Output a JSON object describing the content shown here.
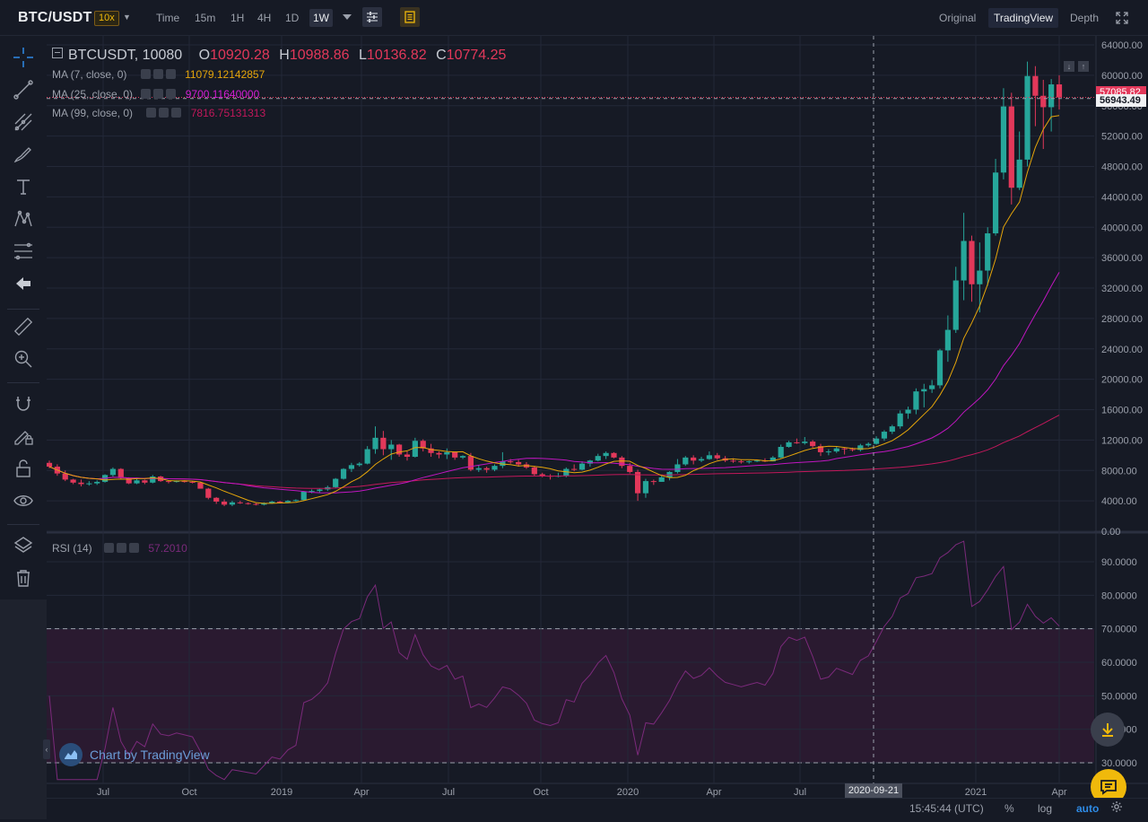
{
  "header": {
    "pair": "BTC/USDT",
    "leverage": "10x",
    "timeframes": [
      "Time",
      "15m",
      "1H",
      "4H",
      "1D",
      "1W"
    ],
    "active_timeframe": "1W",
    "views": [
      "Original",
      "TradingView",
      "Depth"
    ],
    "active_view": "TradingView"
  },
  "legend": {
    "symbol": "BTCUSDT, 10080",
    "open_label": "O",
    "open": "10920.28",
    "high_label": "H",
    "high": "10988.86",
    "low_label": "L",
    "low": "10136.82",
    "close_label": "C",
    "close": "10774.25",
    "ma7_label": "MA (7, close, 0)",
    "ma7_value": "11079.12142857",
    "ma25_label": "MA (25, close, 0)",
    "ma25_value": "9700.11640000",
    "ma99_label": "MA (99, close, 0)",
    "ma99_value": "7816.75131313",
    "rsi_label": "RSI (14)",
    "rsi_value": "57.2010"
  },
  "price_badges": {
    "last_price": "57085.82",
    "crosshair_price": "56943.49"
  },
  "crosshair_date": "2020-09-21",
  "branding": "Chart by TradingView",
  "footer": {
    "clock": "15:45:44 (UTC)",
    "percent": "%",
    "log": "log",
    "auto": "auto"
  },
  "colors": {
    "up": "#26a69a",
    "down": "#e2385a",
    "ma7": "#e5a50a",
    "ma25": "#c016c0",
    "ma99": "#c2185b",
    "rsi": "#7b2a7b",
    "accent": "#f0b90b",
    "background": "#161a25"
  },
  "icons": {
    "tools": [
      "crosshair-icon",
      "trend-line-icon",
      "pitchfork-icon",
      "brush-icon",
      "text-icon",
      "pattern-icon",
      "fib-icon",
      "back-arrow-icon",
      "ruler-icon",
      "zoom-in-icon",
      "magnet-icon",
      "lock-drawing-icon",
      "lock-icon",
      "eye-icon",
      "layers-icon",
      "trash-icon"
    ]
  },
  "chart_data": {
    "type": "candlestick",
    "price_axis": {
      "ticks": [
        "64000.00",
        "60000.00",
        "56000.00",
        "52000.00",
        "48000.00",
        "44000.00",
        "40000.00",
        "36000.00",
        "32000.00",
        "28000.00",
        "24000.00",
        "20000.00",
        "16000.00",
        "12000.00",
        "8000.00",
        "4000.00",
        "0.00"
      ],
      "range": [
        0,
        64000
      ]
    },
    "rsi_axis": {
      "ticks": [
        "90.0000",
        "80.0000",
        "70.0000",
        "60.0000",
        "50.0000",
        "40.0000",
        "30.0000"
      ],
      "range": [
        25,
        97
      ],
      "overbought": 70,
      "oversold": 30
    },
    "time_axis": {
      "labels": [
        "Jul",
        "Oct",
        "2019",
        "Apr",
        "Jul",
        "Oct",
        "2020",
        "Apr",
        "Jul",
        "2021",
        "Apr"
      ],
      "start": "2018-05",
      "end": "2021-04"
    },
    "candles_ohlc_weekly_approx": [
      [
        9000,
        9300,
        8300,
        8500
      ],
      [
        8500,
        8800,
        7300,
        7600
      ],
      [
        7600,
        8000,
        6600,
        6800
      ],
      [
        6800,
        6900,
        6200,
        6400
      ],
      [
        6400,
        6800,
        5900,
        6200
      ],
      [
        6200,
        6600,
        6000,
        6300
      ],
      [
        6300,
        6700,
        6100,
        6500
      ],
      [
        6500,
        7500,
        6400,
        7400
      ],
      [
        7400,
        8400,
        7200,
        8200
      ],
      [
        8200,
        8300,
        6800,
        7000
      ],
      [
        7000,
        7100,
        6200,
        6300
      ],
      [
        6300,
        6900,
        6200,
        6700
      ],
      [
        6700,
        6800,
        6200,
        6400
      ],
      [
        6400,
        7400,
        6300,
        7200
      ],
      [
        7200,
        7300,
        6500,
        6600
      ],
      [
        6600,
        6700,
        6300,
        6500
      ],
      [
        6500,
        6700,
        6400,
        6600
      ],
      [
        6600,
        6700,
        6400,
        6500
      ],
      [
        6500,
        6600,
        6300,
        6400
      ],
      [
        6400,
        6500,
        5800,
        5600
      ],
      [
        5600,
        5700,
        4200,
        4400
      ],
      [
        4400,
        4500,
        3600,
        3900
      ],
      [
        3900,
        4200,
        3300,
        3500
      ],
      [
        3500,
        4000,
        3300,
        3800
      ],
      [
        3800,
        4000,
        3600,
        3700
      ],
      [
        3700,
        3800,
        3500,
        3600
      ],
      [
        3600,
        3700,
        3400,
        3500
      ],
      [
        3500,
        3800,
        3400,
        3700
      ],
      [
        3700,
        4000,
        3600,
        3900
      ],
      [
        3900,
        4000,
        3700,
        3800
      ],
      [
        3800,
        4100,
        3700,
        4000
      ],
      [
        4000,
        4200,
        3900,
        4100
      ],
      [
        4100,
        5300,
        4000,
        5200
      ],
      [
        5200,
        5500,
        5000,
        5300
      ],
      [
        5300,
        5600,
        5100,
        5500
      ],
      [
        5500,
        6000,
        5300,
        5800
      ],
      [
        5800,
        7000,
        5700,
        6900
      ],
      [
        6900,
        8300,
        6800,
        8200
      ],
      [
        8200,
        9000,
        7800,
        8700
      ],
      [
        8700,
        9100,
        8500,
        8900
      ],
      [
        8900,
        11200,
        8800,
        10800
      ],
      [
        10800,
        13800,
        10200,
        12300
      ],
      [
        12300,
        13200,
        10000,
        10800
      ],
      [
        10800,
        12000,
        9400,
        11400
      ],
      [
        11400,
        11500,
        9800,
        10100
      ],
      [
        10100,
        10500,
        9300,
        9800
      ],
      [
        9800,
        12300,
        9700,
        11900
      ],
      [
        11900,
        12100,
        10500,
        10900
      ],
      [
        10900,
        11500,
        9800,
        10300
      ],
      [
        10300,
        10500,
        9600,
        10100
      ],
      [
        10100,
        10900,
        9500,
        10400
      ],
      [
        10400,
        10500,
        9400,
        9700
      ],
      [
        9700,
        10000,
        9500,
        9900
      ],
      [
        9900,
        10300,
        7900,
        8100
      ],
      [
        8100,
        8700,
        7800,
        8300
      ],
      [
        8300,
        8500,
        7700,
        8100
      ],
      [
        8100,
        8800,
        7900,
        8600
      ],
      [
        8600,
        10400,
        8300,
        9200
      ],
      [
        9200,
        9500,
        8900,
        9100
      ],
      [
        9100,
        9400,
        8500,
        8800
      ],
      [
        8800,
        9100,
        8200,
        8400
      ],
      [
        8400,
        8600,
        7300,
        7500
      ],
      [
        7500,
        7700,
        7100,
        7300
      ],
      [
        7300,
        7500,
        6800,
        7200
      ],
      [
        7200,
        7700,
        7100,
        7300
      ],
      [
        7300,
        8400,
        7100,
        8200
      ],
      [
        8200,
        8800,
        7900,
        8100
      ],
      [
        8100,
        9200,
        8000,
        8900
      ],
      [
        8900,
        9400,
        8500,
        9300
      ],
      [
        9300,
        10200,
        9200,
        9900
      ],
      [
        9900,
        10500,
        9500,
        10300
      ],
      [
        10300,
        10400,
        9600,
        9700
      ],
      [
        9700,
        9900,
        8300,
        8600
      ],
      [
        8600,
        9000,
        7600,
        7800
      ],
      [
        7800,
        8100,
        4000,
        5000
      ],
      [
        5000,
        6900,
        4400,
        6600
      ],
      [
        6600,
        6800,
        6100,
        6500
      ],
      [
        6500,
        7300,
        6500,
        7100
      ],
      [
        7100,
        7900,
        6700,
        7800
      ],
      [
        7800,
        9500,
        7600,
        8800
      ],
      [
        8800,
        9900,
        8600,
        9700
      ],
      [
        9700,
        10000,
        8800,
        9300
      ],
      [
        9300,
        9800,
        9100,
        9500
      ],
      [
        9500,
        10500,
        9400,
        10000
      ],
      [
        10000,
        10300,
        9400,
        9600
      ],
      [
        9600,
        9900,
        9100,
        9300
      ],
      [
        9300,
        9600,
        9000,
        9200
      ],
      [
        9200,
        9400,
        8900,
        9100
      ],
      [
        9100,
        9300,
        8900,
        9200
      ],
      [
        9200,
        9400,
        9100,
        9300
      ],
      [
        9300,
        9600,
        9100,
        9200
      ],
      [
        9200,
        9900,
        9200,
        9700
      ],
      [
        9700,
        11400,
        9600,
        11100
      ],
      [
        11100,
        11900,
        11000,
        11700
      ],
      [
        11700,
        12200,
        11500,
        11600
      ],
      [
        11600,
        12400,
        11400,
        11800
      ],
      [
        11800,
        12000,
        11000,
        11200
      ],
      [
        11200,
        11500,
        9900,
        10400
      ],
      [
        10400,
        10800,
        10000,
        10500
      ],
      [
        10500,
        11100,
        10300,
        10900
      ],
      [
        10900,
        11000,
        10100,
        10800
      ],
      [
        10800,
        11000,
        10500,
        10700
      ],
      [
        10700,
        11500,
        10500,
        11300
      ],
      [
        11300,
        11700,
        11100,
        11500
      ],
      [
        11500,
        12500,
        11400,
        12200
      ],
      [
        12200,
        13300,
        11900,
        13100
      ],
      [
        13100,
        14000,
        12800,
        13800
      ],
      [
        13800,
        15900,
        13500,
        15500
      ],
      [
        15500,
        16400,
        14800,
        16000
      ],
      [
        16000,
        18800,
        15400,
        18400
      ],
      [
        18400,
        19400,
        16300,
        18700
      ],
      [
        18700,
        19900,
        18200,
        19200
      ],
      [
        19200,
        24000,
        18800,
        23800
      ],
      [
        23800,
        28400,
        22300,
        26500
      ],
      [
        26500,
        34800,
        26100,
        33000
      ],
      [
        33000,
        41900,
        30400,
        38200
      ],
      [
        38200,
        38900,
        30200,
        32500
      ],
      [
        32500,
        38000,
        28800,
        34300
      ],
      [
        34300,
        40000,
        32300,
        39200
      ],
      [
        39200,
        49000,
        38900,
        47200
      ],
      [
        47200,
        58300,
        46300,
        55900
      ],
      [
        55900,
        57700,
        43000,
        45200
      ],
      [
        45200,
        52600,
        44900,
        48900
      ],
      [
        48900,
        61800,
        48000,
        59900
      ],
      [
        59900,
        61200,
        53300,
        57300
      ],
      [
        57300,
        59400,
        50300,
        55800
      ],
      [
        55800,
        59500,
        52600,
        58800
      ],
      [
        58800,
        60000,
        55500,
        57085
      ]
    ],
    "series": [
      {
        "name": "MA (7, close, 0)",
        "last": 11079.12
      },
      {
        "name": "MA (25, close, 0)",
        "last": 9700.12
      },
      {
        "name": "MA (99, close, 0)",
        "last": 7816.75
      }
    ]
  }
}
